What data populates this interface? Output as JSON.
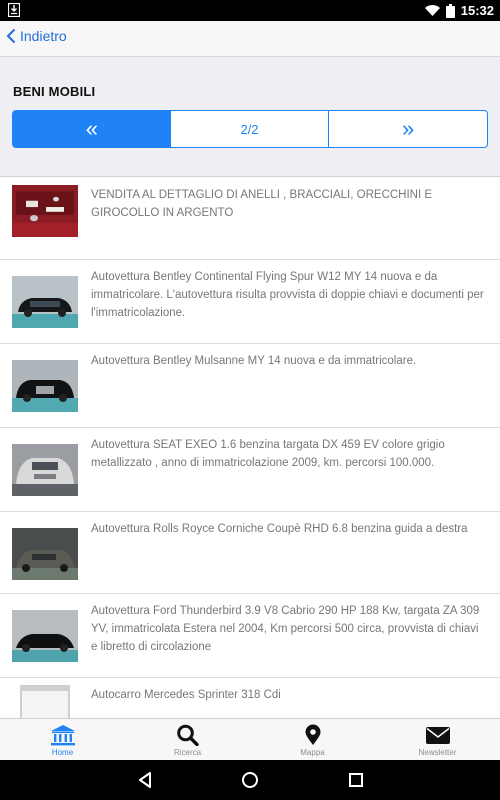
{
  "status": {
    "time": "15:32"
  },
  "topbar": {
    "back_label": "Indietro"
  },
  "section": {
    "title": "BENI MOBILI"
  },
  "pager": {
    "prev": "«",
    "page": "2/2",
    "next": "»"
  },
  "items": [
    {
      "text": "VENDITA AL DETTAGLIO DI ANELLI , BRACCIALI, ORECCHINI E GIROCOLLO IN ARGENTO"
    },
    {
      "text": "Autovettura Bentley Continental Flying Spur W12 MY 14 nuova e da immatricolare. L'autovettura risulta provvista di doppie chiavi e documenti per l'immatricolazione."
    },
    {
      "text": "Autovettura Bentley Mulsanne MY 14 nuova e da immatricolare."
    },
    {
      "text": "Autovettura SEAT EXEO 1.6 benzina targata DX 459 EV colore grigio metallizzato , anno di immatricolazione 2009, km. percorsi 100.000."
    },
    {
      "text": "Autovettura Rolls Royce Corniche Coupè RHD 6.8 benzina guida a destra"
    },
    {
      "text": "Autovettura Ford Thunderbird 3.9 V8 Cabrio 290 HP 188 Kw, targata ZA 309 YV, immatricolata Estera nel 2004, Km percorsi 500 circa, provvista di chiavi e libretto di circolazione"
    },
    {
      "text": "Autocarro Mercedes Sprinter 318 Cdi"
    }
  ],
  "tabs": [
    {
      "label": "Home",
      "icon": "bank-icon",
      "active": true
    },
    {
      "label": "Ricerca",
      "icon": "search-icon",
      "active": false
    },
    {
      "label": "Mappa",
      "icon": "map-pin-icon",
      "active": false
    },
    {
      "label": "Newsletter",
      "icon": "envelope-icon",
      "active": false
    }
  ],
  "colors": {
    "accent": "#1f82f5",
    "link": "#1f6fd8",
    "text_muted": "#777777"
  }
}
